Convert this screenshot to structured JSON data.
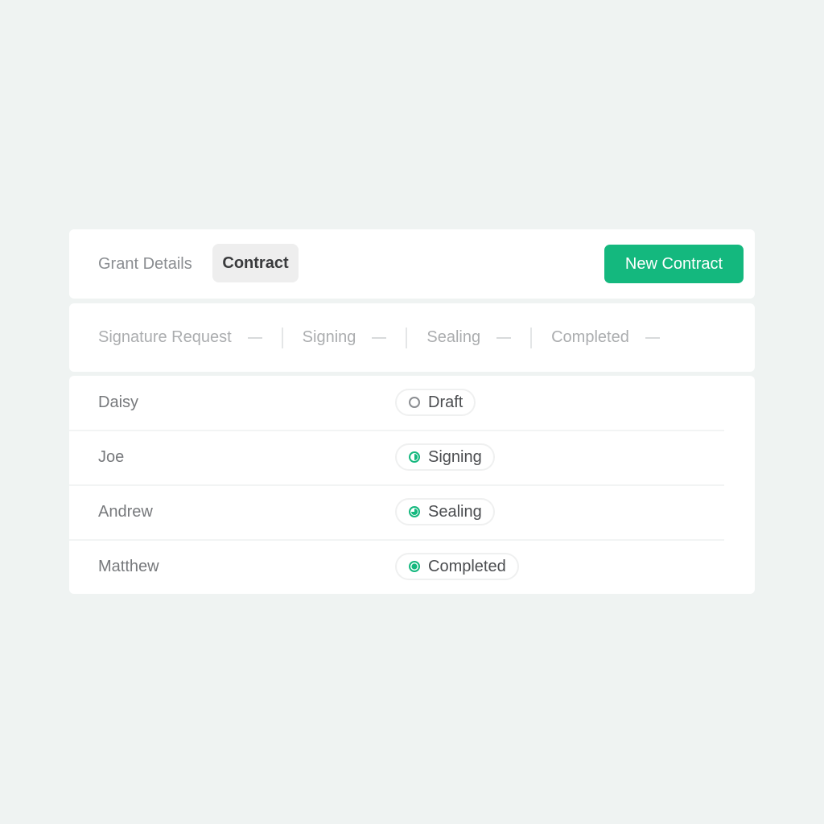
{
  "header": {
    "tabs": [
      {
        "label": "Grant Details",
        "active": false
      },
      {
        "label": "Contract",
        "active": true
      }
    ],
    "primary_action": "New Contract"
  },
  "colors": {
    "accent": "#14b87e",
    "background": "#eff3f2",
    "draft": "#8a8d91"
  },
  "steps": [
    {
      "label": "Signature Request",
      "count": "—"
    },
    {
      "label": "Signing",
      "count": "—"
    },
    {
      "label": "Sealing",
      "count": "—"
    },
    {
      "label": "Completed",
      "count": "—"
    }
  ],
  "rows": [
    {
      "name": "Daisy",
      "status": "Draft",
      "status_icon": "empty-circle-icon"
    },
    {
      "name": "Joe",
      "status": "Signing",
      "status_icon": "half-circle-icon"
    },
    {
      "name": "Andrew",
      "status": "Sealing",
      "status_icon": "three-quarter-circle-icon"
    },
    {
      "name": "Matthew",
      "status": "Completed",
      "status_icon": "filled-circle-icon"
    }
  ]
}
